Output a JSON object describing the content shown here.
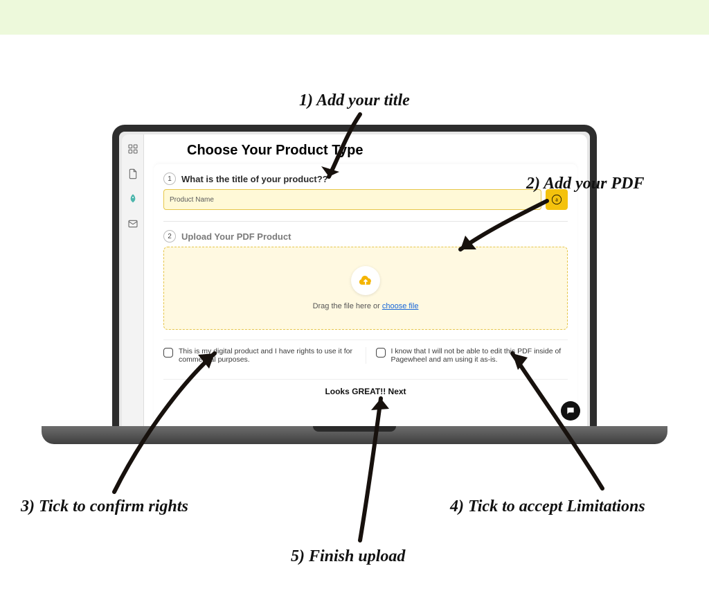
{
  "page": {
    "title": "Choose Your Product Type",
    "step1": {
      "num": "1",
      "label": "What is the title of your product??",
      "placeholder": "Product Name"
    },
    "step2": {
      "num": "2",
      "label": "Upload Your PDF Product",
      "drag_prefix": "Drag the file here or ",
      "choose_link": "choose file"
    },
    "ack": {
      "rights": "This is my digital product and I have rights to use it for commercial purposes.",
      "limits": "I know that I will not be able to edit this PDF inside of Pagewheel and am using it as-is."
    },
    "next_label": "Looks GREAT!! Next"
  },
  "annotations": {
    "a1": "1) Add your title",
    "a2": "2) Add your PDF",
    "a3": "3) Tick to confirm rights",
    "a4": "4) Tick to accept Limitations",
    "a5": "5) Finish upload"
  }
}
